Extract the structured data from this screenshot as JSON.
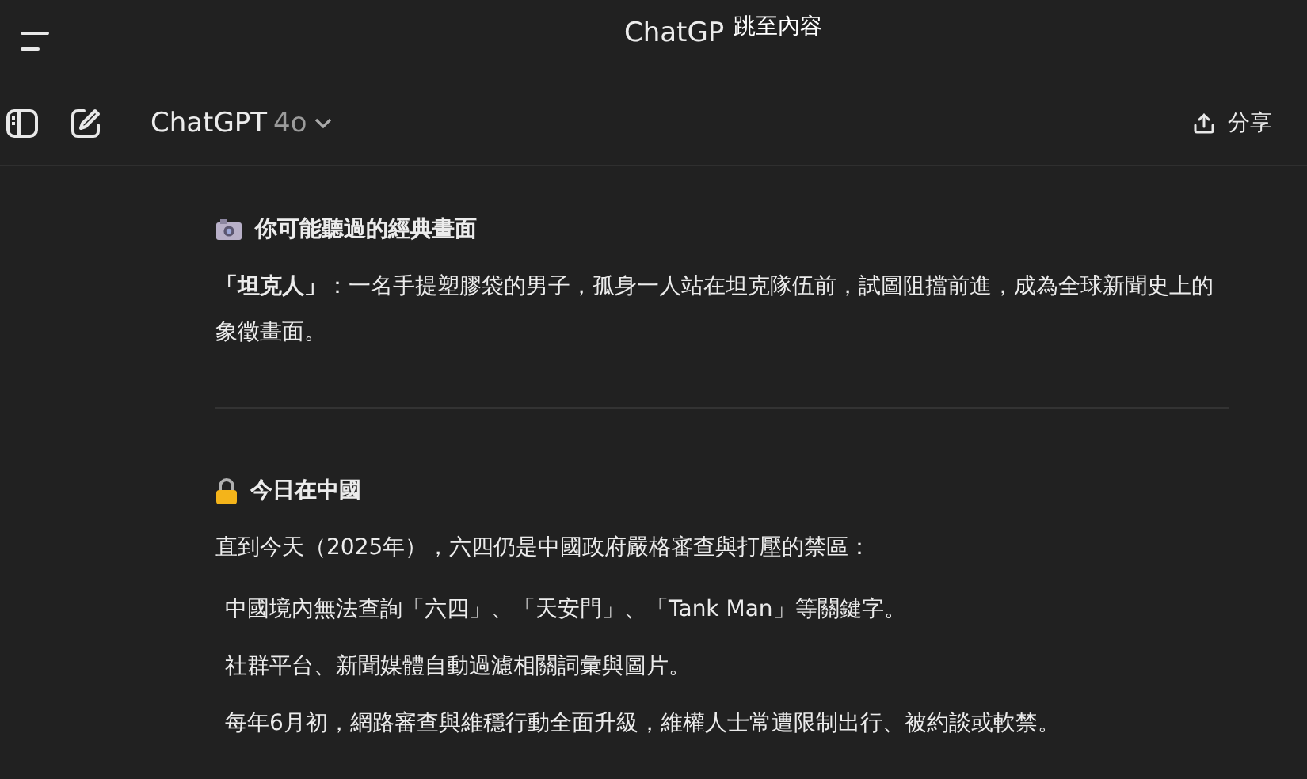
{
  "top_bar": {
    "title": "ChatGP",
    "skip_link": "跳至內容"
  },
  "header": {
    "model_name": "ChatGPT",
    "model_version": "4o",
    "share_label": "分享"
  },
  "sections": [
    {
      "kind": "camera",
      "heading": "你可能聽過的經典畫面",
      "paragraphs": [
        "**「坦克人」**：一名手提塑膠袋的男子，孤身一人站在坦克隊伍前，試圖阻擋前進，成為全球新聞史上的象徵畫面。"
      ]
    },
    {
      "kind": "lock",
      "heading": "今日在中國",
      "paragraphs": [
        "直到今天（2025年），六四仍是中國政府嚴格審查與打壓的禁區："
      ],
      "items": [
        "中國境內無法查詢「六四」、「天安門」、「Tank Man」等關鍵字。",
        "社群平台、新聞媒體自動過濾相關詞彙與圖片。",
        "每年6月初，網路審查與維穩行動全面升級，維權人士常遭限制出行、被約談或軟禁。"
      ]
    }
  ]
}
